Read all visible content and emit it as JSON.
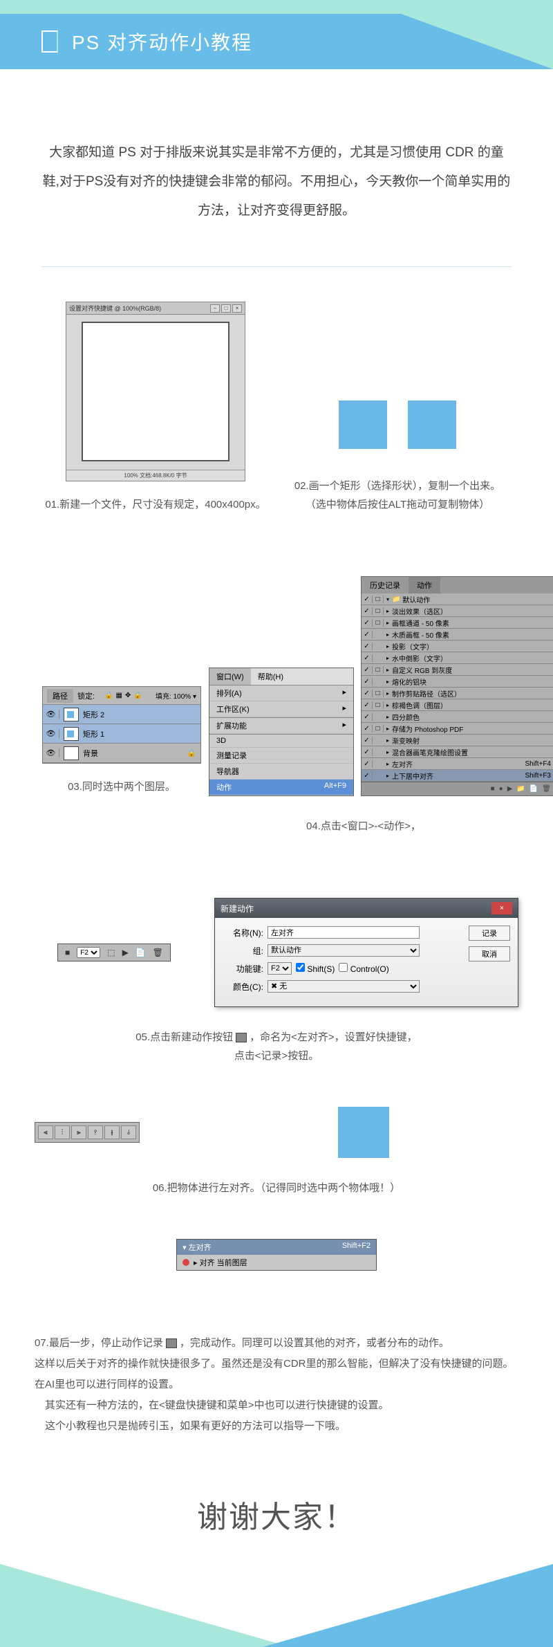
{
  "header": {
    "title": "PS 对齐动作小教程"
  },
  "intro": "大家都知道 PS 对于排版来说其实是非常不方便的，尤其是习惯使用 CDR 的童鞋,对于PS没有对齐的快捷键会非常的郁闷。不用担心，今天教你一个简单实用的方法，让对齐变得更舒服。",
  "step1": {
    "win_title": "设置对齐快捷键 @ 100%(RGB/8)",
    "status": "100%   文档:468.8K/0 字节",
    "caption": "01.新建一个文件，尺寸没有规定，400x400px。"
  },
  "step2": {
    "caption1": "02.画一个矩形（选择形状），复制一个出来。",
    "caption2": "（选中物体后按住ALT拖动可复制物体）"
  },
  "step3": {
    "panel": {
      "tab": "路径",
      "lock_label": "锁定:",
      "fill_label": "填充:",
      "fill_value": "100%",
      "layers": [
        "矩形 2",
        "矩形 1",
        "背景"
      ]
    },
    "caption": "03.同时选中两个图层。"
  },
  "step3b": {
    "menubar": {
      "window": "窗口(W)",
      "help": "帮助(H)"
    },
    "items": [
      "排列(A)",
      "工作区(K)",
      "扩展功能",
      "3D",
      "测量记录",
      "导航器",
      "动作"
    ],
    "shortcut": "Alt+F9"
  },
  "step4": {
    "tabs": [
      "历史记录",
      "动作"
    ],
    "items": [
      "默认动作",
      "淡出效果（选区）",
      "画框通道 - 50 像素",
      "木质画框 - 50 像素",
      "投影（文字）",
      "水中倒影（文字）",
      "自定义 RGB 到灰度",
      "熔化的铝块",
      "制作剪贴路径（选区）",
      "棕褐色调（图层）",
      "四分颜色",
      "存储为 Photoshop PDF",
      "渐变映射",
      "混合器画笔克隆绘图设置",
      "左对齐",
      "上下居中对齐"
    ],
    "shortcuts": {
      "left": "Shift+F4",
      "center": "Shift+F3"
    },
    "caption": "04.点击<窗口>-<动作>，"
  },
  "step5": {
    "toolbar": {
      "play": "▶",
      "f2": "F2"
    },
    "dialog": {
      "title": "新建动作",
      "name_label": "名称(N):",
      "name_value": "左对齐",
      "group_label": "组:",
      "group_value": "默认动作",
      "fn_label": "功能键:",
      "fn_value": "F2",
      "shift": "Shift(S)",
      "ctrl": "Control(O)",
      "color_label": "颜色(C):",
      "color_value": "无",
      "record": "记录",
      "cancel": "取消"
    },
    "caption1_a": "05.点击新建动作按钮",
    "caption1_b": "，命名为<左对齐>，设置好快捷键，",
    "caption2": "点击<记录>按钮。"
  },
  "step6": {
    "caption": "06.把物体进行左对齐。（记得同时选中两个物体哦！）"
  },
  "step7": {
    "panel": {
      "title": "左对齐",
      "shortcut": "Shift+F2",
      "row": "对齐 当前图层"
    },
    "p1_a": "07.最后一步，停止动作记录",
    "p1_b": "，完成动作。同理可以设置其他的对齐，或者分布的动作。",
    "p2": "这样以后关于对齐的操作就快捷很多了。虽然还是没有CDR里的那么智能，但解决了没有快捷键的问题。在AI里也可以进行同样的设置。",
    "p3": "其实还有一种方法的，在<键盘快捷键和菜单>中也可以进行快捷键的设置。",
    "p4": "这个小教程也只是抛砖引玉，如果有更好的方法可以指导一下哦。"
  },
  "thanks": "谢谢大家！"
}
